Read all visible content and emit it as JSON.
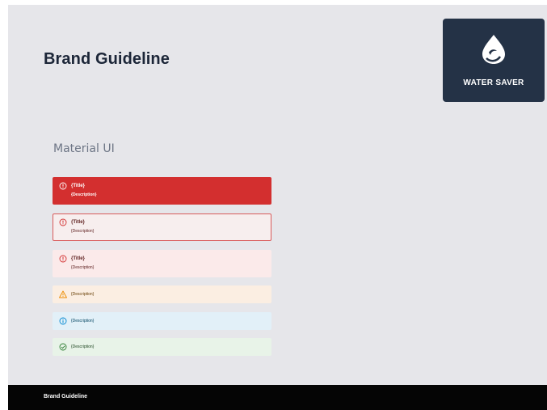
{
  "header": {
    "title": "Brand Guideline",
    "logo": {
      "text": "WATER SAVER",
      "icon": "water-drop-icon",
      "background": "#243246"
    }
  },
  "section": {
    "title": "Material UI"
  },
  "alerts": [
    {
      "variant": "filled-error",
      "icon": "error-circle-icon",
      "title": "{Title}",
      "description": "{Description}",
      "color": "#d32f2f"
    },
    {
      "variant": "outlined-error",
      "icon": "error-circle-icon",
      "title": "{Title}",
      "description": "{Description}",
      "color": "#d95b5b"
    },
    {
      "variant": "standard-error",
      "icon": "error-circle-icon",
      "title": "{Title}",
      "description": "{Description}",
      "color": "#fbeaea"
    },
    {
      "variant": "standard-warning",
      "icon": "warning-triangle-icon",
      "description": "{Description}",
      "color": "#fbeee2"
    },
    {
      "variant": "standard-info",
      "icon": "info-circle-icon",
      "description": "{Description}",
      "color": "#e2f0f8"
    },
    {
      "variant": "standard-success",
      "icon": "success-check-icon",
      "description": "{Description}",
      "color": "#e8f3e8"
    }
  ],
  "footer": {
    "text": "Brand Guideline"
  }
}
